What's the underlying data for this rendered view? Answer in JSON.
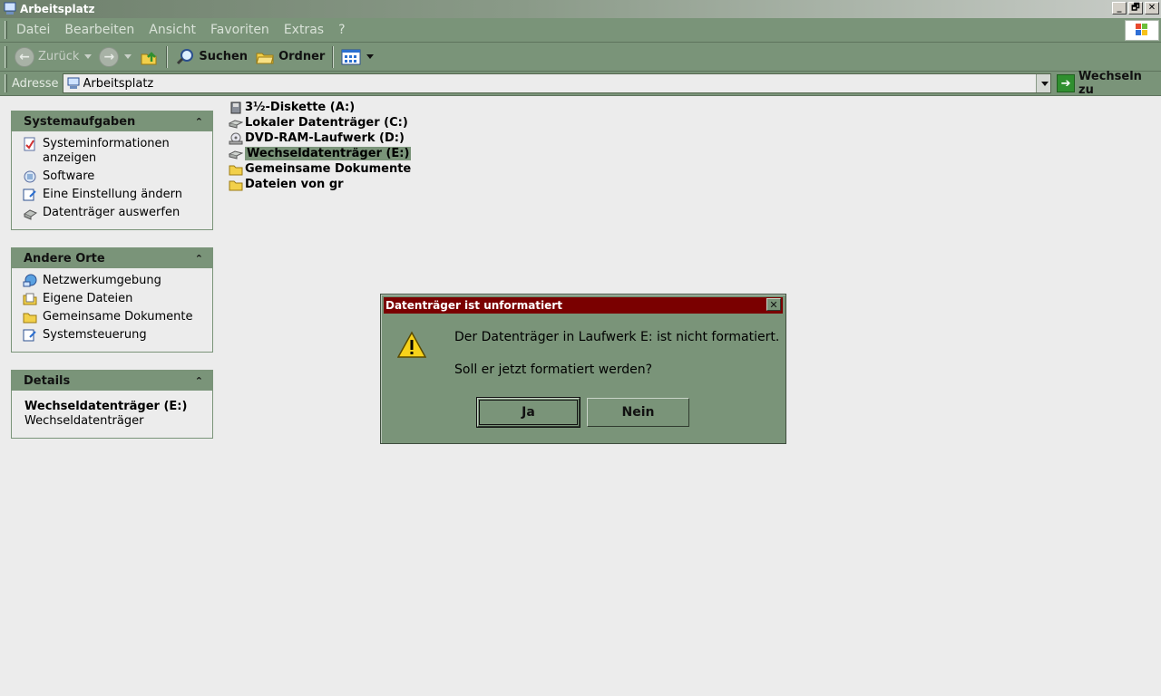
{
  "window": {
    "title": "Arbeitsplatz"
  },
  "window_controls": {
    "minimize": "_",
    "maximize": "🗗",
    "close": "✕"
  },
  "menu": [
    "Datei",
    "Bearbeiten",
    "Ansicht",
    "Favoriten",
    "Extras",
    "?"
  ],
  "toolbar": {
    "back_label": "Zurück",
    "search_label": "Suchen",
    "folders_label": "Ordner"
  },
  "address": {
    "label": "Adresse",
    "value": "Arbeitsplatz",
    "go_label": "Wechseln zu"
  },
  "panels": {
    "system_tasks": {
      "title": "Systemaufgaben",
      "items": [
        "Systeminformationen anzeigen",
        "Software",
        "Eine Einstellung ändern",
        "Datenträger auswerfen"
      ]
    },
    "other_places": {
      "title": "Andere Orte",
      "items": [
        "Netzwerkumgebung",
        "Eigene Dateien",
        "Gemeinsame Dokumente",
        "Systemsteuerung"
      ]
    },
    "details": {
      "title": "Details",
      "lines": [
        "Wechseldatenträger (E:)",
        "Wechseldatenträger"
      ]
    }
  },
  "files": [
    {
      "label": "3½-Diskette (A:)",
      "icon": "floppy-icon"
    },
    {
      "label": "Lokaler Datenträger (C:)",
      "icon": "hard-drive-icon"
    },
    {
      "label": "DVD-RAM-Laufwerk (D:)",
      "icon": "dvd-drive-icon"
    },
    {
      "label": "Wechseldatenträger (E:)",
      "icon": "removable-drive-icon",
      "selected": true
    },
    {
      "label": "Gemeinsame Dokumente",
      "icon": "folder-icon"
    },
    {
      "label": "Dateien von gr",
      "icon": "folder-icon"
    }
  ],
  "dialog": {
    "title": "Datenträger ist unformatiert",
    "message": "Der Datenträger in Laufwerk E: ist nicht formatiert.",
    "question": "Soll er jetzt formatiert werden?",
    "yes_label": "Ja",
    "no_label": "Nein"
  },
  "colors": {
    "accent": "#7a9479",
    "dialog_title": "#7a0000",
    "background": "#ececec"
  }
}
